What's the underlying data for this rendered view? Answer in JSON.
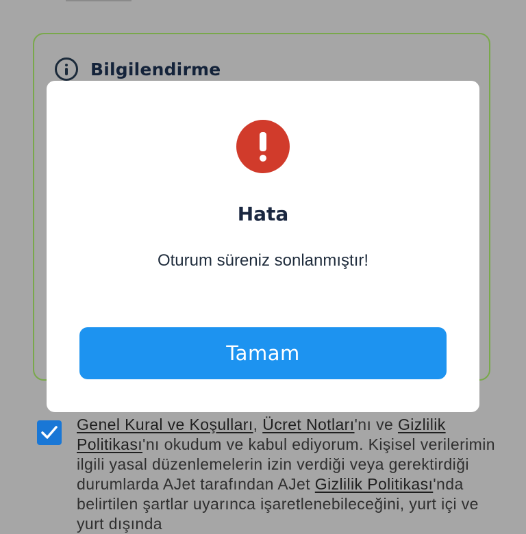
{
  "info_card": {
    "title": "Bilgilendirme",
    "icon": "info-circle-icon",
    "border_color": "#79a84b"
  },
  "modal": {
    "icon": "error-circle-icon",
    "icon_color": "#d13b2b",
    "title": "Hata",
    "message": "Oturum süreniz sonlanmıştır!",
    "button_label": "Tamam",
    "button_color": "#1d93f0"
  },
  "consent": {
    "checked": true,
    "checkbox_color": "#1977d6",
    "link_general_terms": "Genel Kural ve Koşulları",
    "sep_1": ", ",
    "link_fee_notes": "Ücret Notları",
    "text_1": "'nı ve ",
    "link_privacy_1": "Gizlilik Politikası",
    "text_2": "'nı okudum ve kabul ediyorum. Kişisel verilerimin ilgili yasal düzenlemelerin izin verdiği veya gerektirdiği durumlarda AJet tarafından AJet ",
    "link_privacy_2": "Gizlilik Politikası",
    "text_3": "'nda belirtilen şartlar uyarınca işaretlenebileceğini, yurt içi ve yurt dışında"
  }
}
